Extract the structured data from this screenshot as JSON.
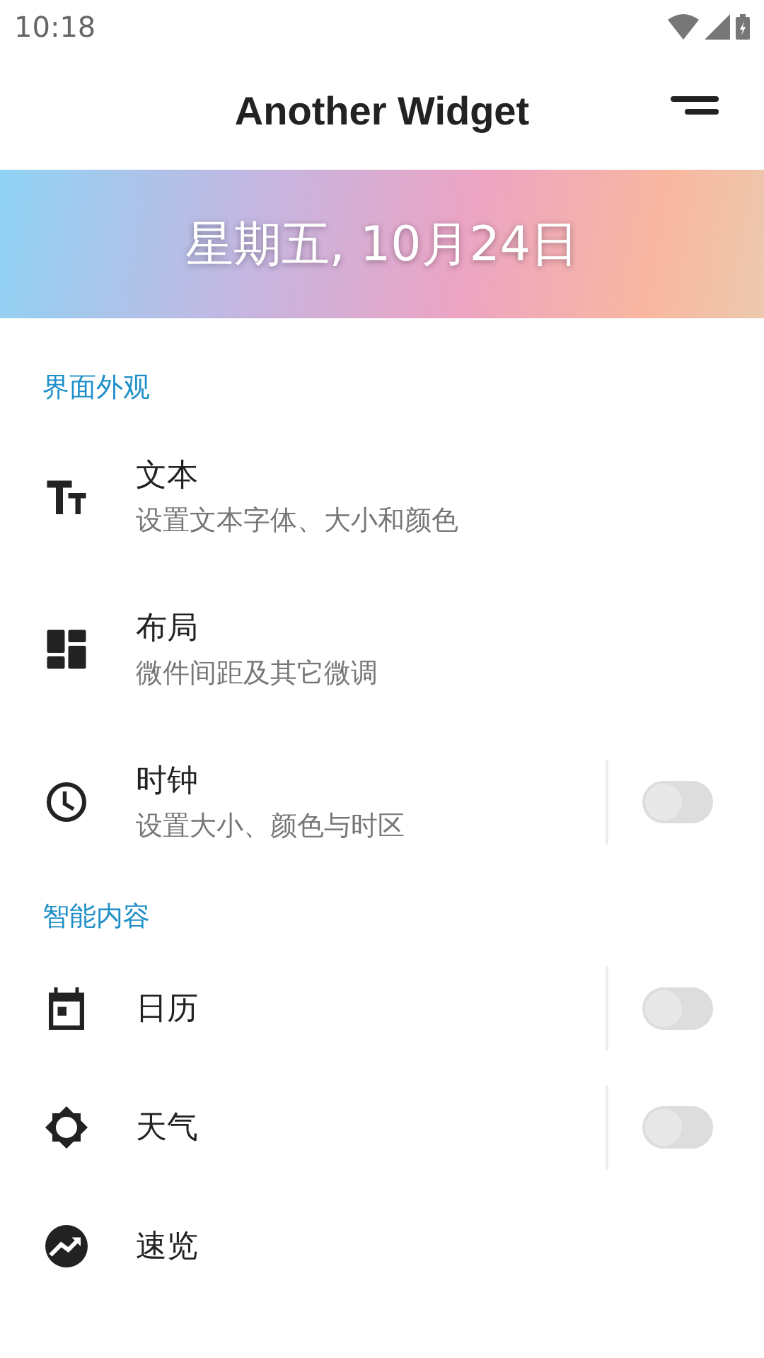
{
  "status_bar": {
    "time": "10:18"
  },
  "app_bar": {
    "title": "Another Widget"
  },
  "banner": {
    "date": "星期五, 10月24日"
  },
  "sections": [
    {
      "title": "界面外观",
      "items": [
        {
          "title": "文本",
          "subtitle": "设置文本字体、大小和颜色"
        },
        {
          "title": "布局",
          "subtitle": "微件间距及其它微调"
        },
        {
          "title": "时钟",
          "subtitle": "设置大小、颜色与时区",
          "toggle": {
            "on": false
          }
        }
      ]
    },
    {
      "title": "智能内容",
      "items": [
        {
          "title": "日历",
          "toggle": {
            "on": false
          }
        },
        {
          "title": "天气",
          "toggle": {
            "on": false
          }
        },
        {
          "title": "速览"
        }
      ]
    }
  ]
}
